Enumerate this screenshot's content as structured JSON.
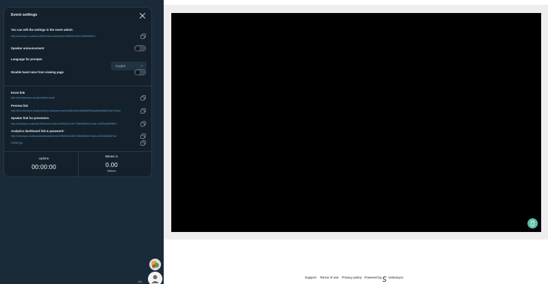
{
  "panel": {
    "title": "Event settings",
    "edit_label": "You can edit the settings in the event admin:",
    "admin_link": "http://videosync.localhost:3000/event-admin/test1995d25c3c3b1798fd0585c0",
    "speaker_announcement_label": "Speaker announcement",
    "speaker_announcement_on": false,
    "language_label": "Language for prompts",
    "language_value": "English",
    "disable_hand_raise_label": "Disable hand raise from viewing page",
    "disable_hand_raise_on": false,
    "event_link_label": "Event link",
    "event_link": "http://test.videosync.localhost/test-mode",
    "preview_link_label": "Preview link",
    "preview_link": "http://test.videosync.localhost/test-mode/preview/a2c68ecd3ee48d98f6f0f34da6a9a5f8af19ae7f3ba0",
    "speaker_link_label": "Speaker link for presenters",
    "speaker_link": "http://videosync.localhost:3000/web-studio/1995d25c3c3b1798fd0585c0?code=1f52f3ad8f0ff8e0",
    "analytics_label": "Analytics dashboard link & password:",
    "analytics_link": "http://videosync.localhost/dashboard/event/1995d25c3c3b1798fd0585c0?token=5034d8dfd1f7a0",
    "password": "FMBB7ygr"
  },
  "stats": {
    "uptime_label": "Uptime",
    "uptime_value": "00:00:00",
    "bitrate_label": "Bitrate in",
    "bitrate_value": "0.00",
    "bitrate_unit": "Mbits/s"
  },
  "sidebar": {
    "viewer_count": "2H"
  },
  "footer": {
    "support": "Support",
    "terms": "Terms of use",
    "privacy": "Privacy policy",
    "powered_by": "Powered by",
    "brand": "Videosync"
  },
  "colors": {
    "sidebar_bg": "#1b2a38",
    "panel_bg": "#14212c",
    "link": "#5ea0c9",
    "raise_button": "#5bbda8"
  }
}
